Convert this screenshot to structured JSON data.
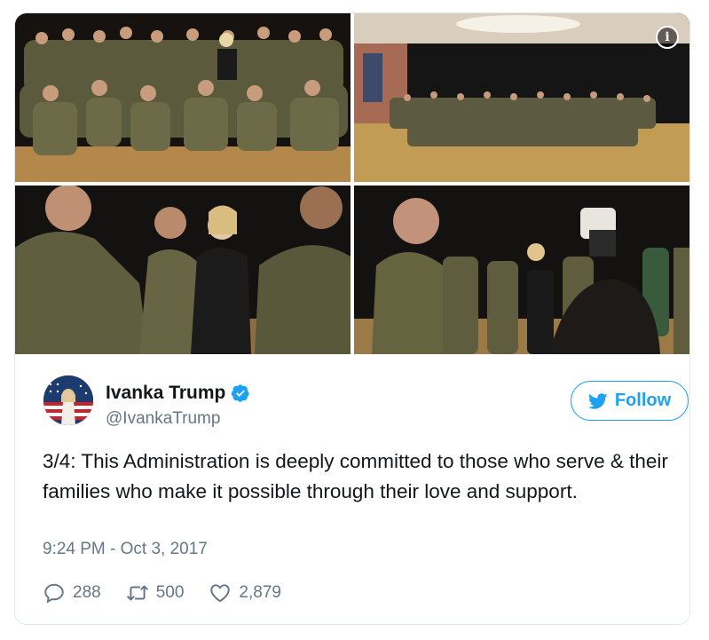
{
  "media": {
    "photo_count": 4,
    "info_icon": "info-icon"
  },
  "author": {
    "name": "Ivanka Trump",
    "handle": "@IvankaTrump",
    "verified": true,
    "verified_icon": "verified-badge-icon"
  },
  "follow_button": {
    "label": "Follow",
    "icon": "twitter-bird-icon",
    "color": "#1da1f2"
  },
  "tweet": {
    "text": "3/4: This Administration is deeply committed to those who serve & their families who make it possible through their love and support.",
    "timestamp": "9:24 PM - Oct 3, 2017"
  },
  "actions": {
    "replies": "288",
    "retweets": "500",
    "likes": "2,879"
  },
  "colors": {
    "text": "#14171a",
    "secondary": "#657786",
    "accent": "#1da1f2",
    "border": "#e1e8ed"
  }
}
